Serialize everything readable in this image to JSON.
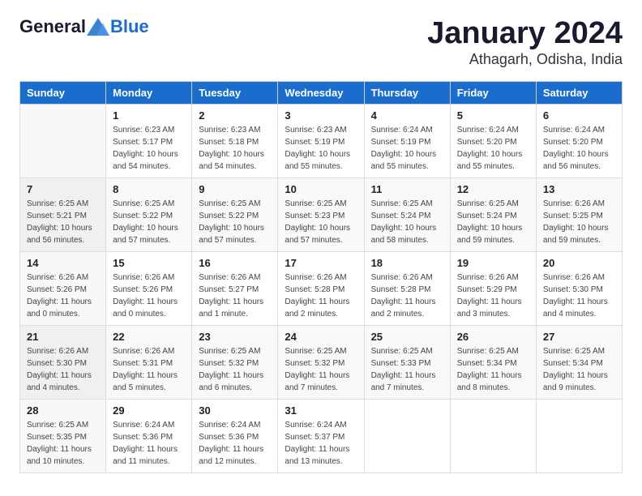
{
  "header": {
    "logo": {
      "general": "General",
      "blue": "Blue"
    },
    "title": "January 2024",
    "location": "Athagarh, Odisha, India"
  },
  "columns": [
    "Sunday",
    "Monday",
    "Tuesday",
    "Wednesday",
    "Thursday",
    "Friday",
    "Saturday"
  ],
  "weeks": [
    [
      {
        "day": "",
        "info": ""
      },
      {
        "day": "1",
        "info": "Sunrise: 6:23 AM\nSunset: 5:17 PM\nDaylight: 10 hours\nand 54 minutes."
      },
      {
        "day": "2",
        "info": "Sunrise: 6:23 AM\nSunset: 5:18 PM\nDaylight: 10 hours\nand 54 minutes."
      },
      {
        "day": "3",
        "info": "Sunrise: 6:23 AM\nSunset: 5:19 PM\nDaylight: 10 hours\nand 55 minutes."
      },
      {
        "day": "4",
        "info": "Sunrise: 6:24 AM\nSunset: 5:19 PM\nDaylight: 10 hours\nand 55 minutes."
      },
      {
        "day": "5",
        "info": "Sunrise: 6:24 AM\nSunset: 5:20 PM\nDaylight: 10 hours\nand 55 minutes."
      },
      {
        "day": "6",
        "info": "Sunrise: 6:24 AM\nSunset: 5:20 PM\nDaylight: 10 hours\nand 56 minutes."
      }
    ],
    [
      {
        "day": "7",
        "info": "Sunrise: 6:25 AM\nSunset: 5:21 PM\nDaylight: 10 hours\nand 56 minutes."
      },
      {
        "day": "8",
        "info": "Sunrise: 6:25 AM\nSunset: 5:22 PM\nDaylight: 10 hours\nand 57 minutes."
      },
      {
        "day": "9",
        "info": "Sunrise: 6:25 AM\nSunset: 5:22 PM\nDaylight: 10 hours\nand 57 minutes."
      },
      {
        "day": "10",
        "info": "Sunrise: 6:25 AM\nSunset: 5:23 PM\nDaylight: 10 hours\nand 57 minutes."
      },
      {
        "day": "11",
        "info": "Sunrise: 6:25 AM\nSunset: 5:24 PM\nDaylight: 10 hours\nand 58 minutes."
      },
      {
        "day": "12",
        "info": "Sunrise: 6:25 AM\nSunset: 5:24 PM\nDaylight: 10 hours\nand 59 minutes."
      },
      {
        "day": "13",
        "info": "Sunrise: 6:26 AM\nSunset: 5:25 PM\nDaylight: 10 hours\nand 59 minutes."
      }
    ],
    [
      {
        "day": "14",
        "info": "Sunrise: 6:26 AM\nSunset: 5:26 PM\nDaylight: 11 hours\nand 0 minutes."
      },
      {
        "day": "15",
        "info": "Sunrise: 6:26 AM\nSunset: 5:26 PM\nDaylight: 11 hours\nand 0 minutes."
      },
      {
        "day": "16",
        "info": "Sunrise: 6:26 AM\nSunset: 5:27 PM\nDaylight: 11 hours\nand 1 minute."
      },
      {
        "day": "17",
        "info": "Sunrise: 6:26 AM\nSunset: 5:28 PM\nDaylight: 11 hours\nand 2 minutes."
      },
      {
        "day": "18",
        "info": "Sunrise: 6:26 AM\nSunset: 5:28 PM\nDaylight: 11 hours\nand 2 minutes."
      },
      {
        "day": "19",
        "info": "Sunrise: 6:26 AM\nSunset: 5:29 PM\nDaylight: 11 hours\nand 3 minutes."
      },
      {
        "day": "20",
        "info": "Sunrise: 6:26 AM\nSunset: 5:30 PM\nDaylight: 11 hours\nand 4 minutes."
      }
    ],
    [
      {
        "day": "21",
        "info": "Sunrise: 6:26 AM\nSunset: 5:30 PM\nDaylight: 11 hours\nand 4 minutes."
      },
      {
        "day": "22",
        "info": "Sunrise: 6:26 AM\nSunset: 5:31 PM\nDaylight: 11 hours\nand 5 minutes."
      },
      {
        "day": "23",
        "info": "Sunrise: 6:25 AM\nSunset: 5:32 PM\nDaylight: 11 hours\nand 6 minutes."
      },
      {
        "day": "24",
        "info": "Sunrise: 6:25 AM\nSunset: 5:32 PM\nDaylight: 11 hours\nand 7 minutes."
      },
      {
        "day": "25",
        "info": "Sunrise: 6:25 AM\nSunset: 5:33 PM\nDaylight: 11 hours\nand 7 minutes."
      },
      {
        "day": "26",
        "info": "Sunrise: 6:25 AM\nSunset: 5:34 PM\nDaylight: 11 hours\nand 8 minutes."
      },
      {
        "day": "27",
        "info": "Sunrise: 6:25 AM\nSunset: 5:34 PM\nDaylight: 11 hours\nand 9 minutes."
      }
    ],
    [
      {
        "day": "28",
        "info": "Sunrise: 6:25 AM\nSunset: 5:35 PM\nDaylight: 11 hours\nand 10 minutes."
      },
      {
        "day": "29",
        "info": "Sunrise: 6:24 AM\nSunset: 5:36 PM\nDaylight: 11 hours\nand 11 minutes."
      },
      {
        "day": "30",
        "info": "Sunrise: 6:24 AM\nSunset: 5:36 PM\nDaylight: 11 hours\nand 12 minutes."
      },
      {
        "day": "31",
        "info": "Sunrise: 6:24 AM\nSunset: 5:37 PM\nDaylight: 11 hours\nand 13 minutes."
      },
      {
        "day": "",
        "info": ""
      },
      {
        "day": "",
        "info": ""
      },
      {
        "day": "",
        "info": ""
      }
    ]
  ]
}
